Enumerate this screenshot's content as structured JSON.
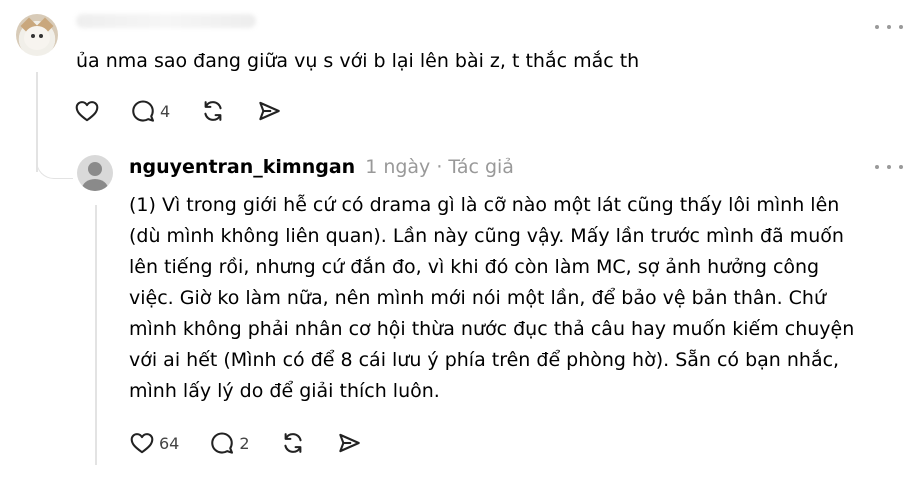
{
  "parent_comment": {
    "text": "ủa nma sao đang giữa vụ s với b lại lên bài z, t thắc mắc th",
    "reply_count": "4"
  },
  "reply": {
    "username": "nguyentran_kimngan",
    "time": "1 ngày",
    "separator": "·",
    "author_label": "Tác giả",
    "text_lines": [
      "(1) Vì trong giới hễ cứ có drama gì là cỡ nào một lát cũng thấy lôi mình lên",
      "(dù mình không liên quan). Lần này cũng vậy. Mấy lần trước mình đã muốn",
      "lên tiếng rồi, nhưng cứ đắn đo, vì khi đó còn làm MC, sợ ảnh hưởng công",
      "việc. Giờ ko làm nữa, nên mình mới nói một lần, để bảo vệ bản thân. Chứ",
      "mình không phải nhân cơ hội thừa nước đục thả câu hay muốn kiếm chuyện",
      "với ai hết (Mình có để 8 cái lưu ý phía trên để phòng hờ). Sẵn có bạn nhắc,",
      "mình lấy lý do để giải thích luôn."
    ],
    "like_count": "64",
    "reply_count": "2"
  },
  "icons": {
    "like": "heart-icon",
    "comment": "comment-bubble-icon",
    "repost": "repost-icon",
    "share": "send-icon",
    "more": "more-dots-icon"
  }
}
